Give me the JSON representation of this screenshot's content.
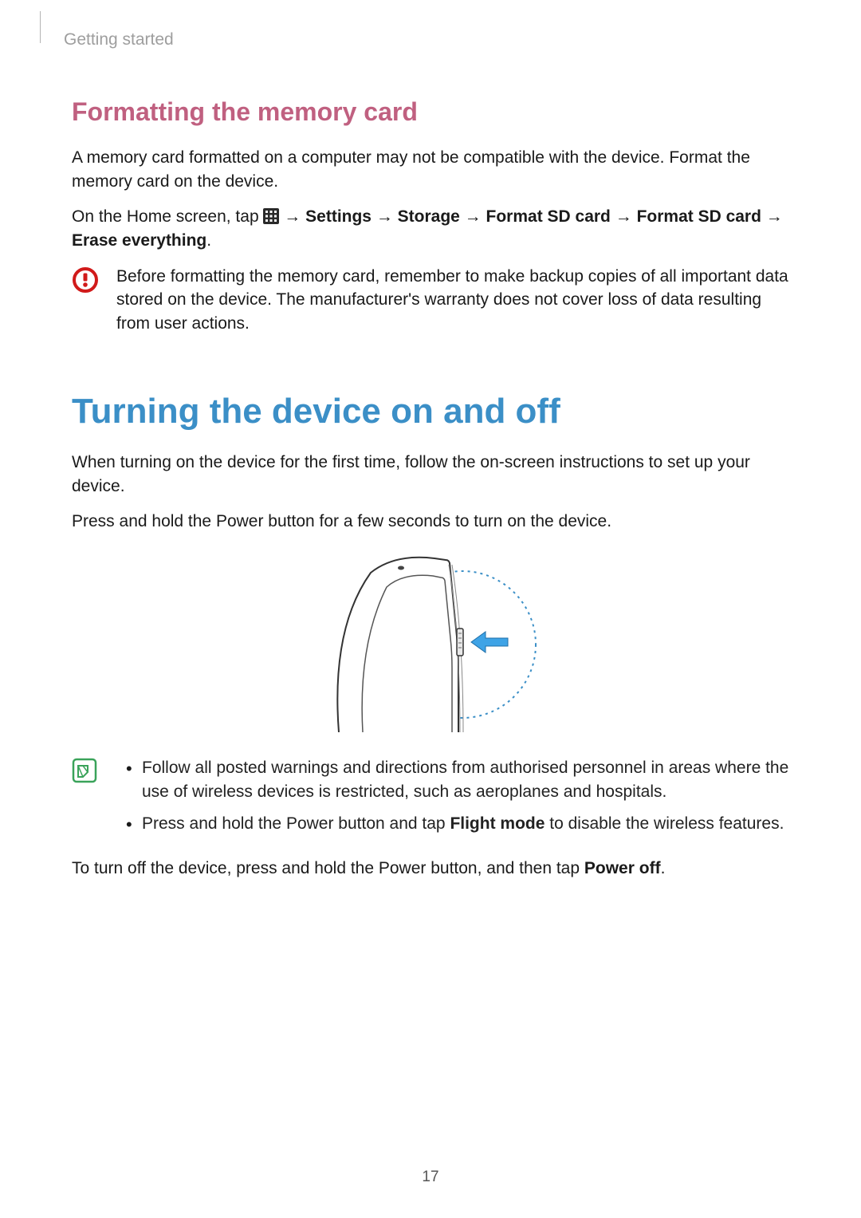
{
  "header": {
    "breadcrumb": "Getting started"
  },
  "section1": {
    "heading": "Formatting the memory card",
    "p1": "A memory card formatted on a computer may not be compatible with the device. Format the memory card on the device.",
    "instr_prefix": "On the Home screen, tap ",
    "arrow": " → ",
    "settings": "Settings",
    "storage": "Storage",
    "fmt1": "Format SD card",
    "fmt2": "Format SD card",
    "erase": "Erase everything",
    "period": ".",
    "caution": "Before formatting the memory card, remember to make backup copies of all important data stored on the device. The manufacturer's warranty does not cover loss of data resulting from user actions."
  },
  "section2": {
    "heading": "Turning the device on and off",
    "p1": "When turning on the device for the first time, follow the on-screen instructions to set up your device.",
    "p2": "Press and hold the Power button for a few seconds to turn on the device.",
    "note_item1": "Follow all posted warnings and directions from authorised personnel in areas where the use of wireless devices is restricted, such as aeroplanes and hospitals.",
    "note_item2a": "Press and hold the Power button and tap ",
    "note_item2b_bold": "Flight mode",
    "note_item2c": " to disable the wireless features.",
    "p3a": "To turn off the device, press and hold the Power button, and then tap ",
    "p3b_bold": "Power off",
    "p3c": "."
  },
  "page_number": "17"
}
